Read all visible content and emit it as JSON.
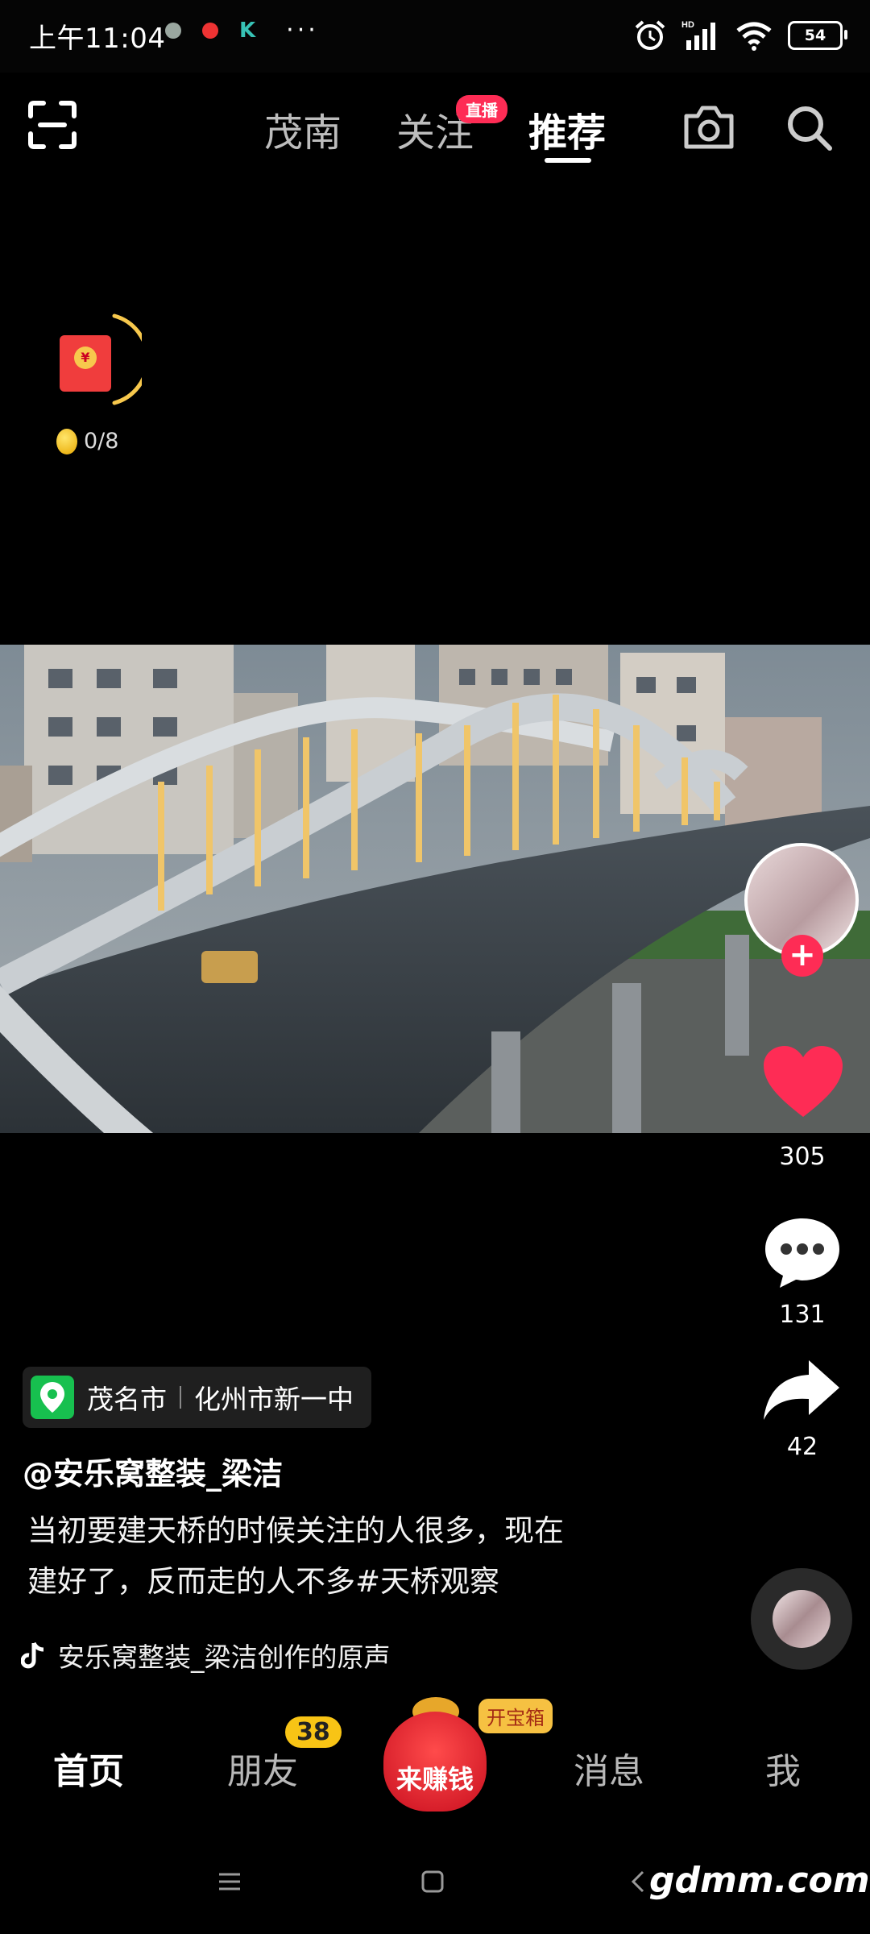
{
  "status_bar": {
    "time": "上午11:04",
    "app_icons": [
      "wechat-icon",
      "app-red-icon",
      "k-app-icon"
    ],
    "more": "···",
    "k_label": "K",
    "battery": "54",
    "hd_label": "HD"
  },
  "top_nav": {
    "tabs": [
      "茂南",
      "关注",
      "推荐"
    ],
    "active_tab": "推荐",
    "live_badge": "直播"
  },
  "task_widget": {
    "coin_symbol": "¥",
    "progress": "0/8"
  },
  "video": {
    "description": "bridge at dusk"
  },
  "right_rail": {
    "likes": "305",
    "comments": "131",
    "shares": "42",
    "follow_symbol": "+"
  },
  "location": {
    "city": "茂名市",
    "place": "化州市新一中"
  },
  "author": "@安乐窝整装_梁洁",
  "caption_line1": "当初要建天桥的时候关注的人很多，现在",
  "caption_line2": "建好了，反而走的人不多#天桥观察",
  "music": "安乐窝整装_梁洁创作的原声",
  "bottom_nav": {
    "home": "首页",
    "friends": "朋友",
    "friends_badge": "38",
    "earn": "来赚钱",
    "chest": "开宝箱",
    "messages": "消息",
    "me": "我"
  },
  "watermark": "gdmm.com",
  "colors": {
    "accent": "#fe2c55",
    "location_green": "#17c04f",
    "badge_yellow": "#f8c415"
  }
}
